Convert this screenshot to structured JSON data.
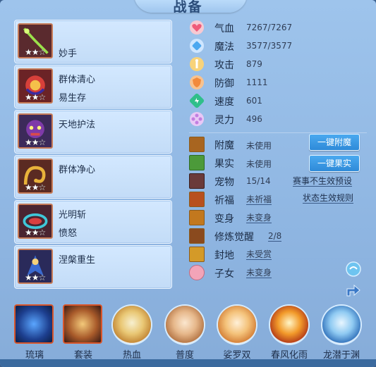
{
  "title": "战备",
  "skills": [
    {
      "name": "妙手",
      "subtitle": "",
      "stars": "★★☆",
      "icon": "green-whip-icon"
    },
    {
      "name": "群体清心",
      "subtitle": "易生存",
      "stars": "★★☆",
      "icon": "red-orb-icon"
    },
    {
      "name": "天地护法",
      "subtitle": "",
      "stars": "★★☆",
      "icon": "mask-guardian-icon"
    },
    {
      "name": "群体净心",
      "subtitle": "",
      "stars": "★★☆",
      "icon": "golden-snake-icon"
    },
    {
      "name": "光明斩",
      "subtitle": "愤怒",
      "stars": "★★☆",
      "icon": "chakram-icon"
    },
    {
      "name": "涅槃重生",
      "subtitle": "",
      "stars": "★★☆",
      "icon": "phoenix-warrior-icon"
    }
  ],
  "stats": [
    {
      "label": "气血",
      "value": "7267/7267",
      "icon": "heart-icon",
      "color": "#ef5b7a"
    },
    {
      "label": "魔法",
      "value": "3577/3577",
      "icon": "diamond-icon",
      "color": "#4da8f0"
    },
    {
      "label": "攻击",
      "value": "879",
      "icon": "attack-icon",
      "color": "#f2a531"
    },
    {
      "label": "防御",
      "value": "1111",
      "icon": "defense-icon",
      "color": "#f28a3c"
    },
    {
      "label": "速度",
      "value": "601",
      "icon": "speed-icon",
      "color": "#2fbf8a"
    },
    {
      "label": "灵力",
      "value": "496",
      "icon": "spirit-icon",
      "color": "#c27ee0"
    }
  ],
  "misc": [
    {
      "label": "附魔",
      "value": "未使用",
      "underline": false,
      "icon": "enchant-icon"
    },
    {
      "label": "果实",
      "value": "未使用",
      "underline": false,
      "icon": "fruit-icon"
    },
    {
      "label": "宠物",
      "value": "15/14",
      "underline": false,
      "icon": "pet-icon"
    },
    {
      "label": "祈福",
      "value": "未祈福",
      "underline": true,
      "icon": "blessing-icon"
    },
    {
      "label": "变身",
      "value": "未变身",
      "underline": true,
      "icon": "transform-icon"
    },
    {
      "label": "修炼觉醒",
      "value": "2/8",
      "underline": true,
      "icon": "cultivation-icon"
    },
    {
      "label": "封地",
      "value": "未受赏",
      "underline": true,
      "icon": "fief-icon"
    },
    {
      "label": "子女",
      "value": "未变身",
      "underline": true,
      "icon": "child-icon"
    }
  ],
  "buttons": {
    "enchant": "一键附魔",
    "fruit": "一键果实"
  },
  "links": {
    "pet_note": "赛事不生效预设",
    "bless_rule": "状态生效规则"
  },
  "bottom_items": [
    {
      "label": "琉璃",
      "kind": "square",
      "underline": true,
      "icon": "glass-orb-icon"
    },
    {
      "label": "套装",
      "kind": "square",
      "underline": true,
      "icon": "armor-set-icon"
    },
    {
      "label": "热血",
      "kind": "circle",
      "underline": false,
      "icon": "hot-blood-icon"
    },
    {
      "label": "普度",
      "kind": "circle",
      "underline": false,
      "icon": "salvation-hand-icon"
    },
    {
      "label": "娑罗双",
      "kind": "circle",
      "underline": false,
      "icon": "sala-leaf-icon"
    },
    {
      "label": "春风化雨",
      "kind": "circle",
      "underline": false,
      "icon": "spring-rain-icon"
    },
    {
      "label": "龙潜于渊",
      "kind": "circle",
      "underline": true,
      "icon": "dragon-abyss-icon"
    }
  ]
}
